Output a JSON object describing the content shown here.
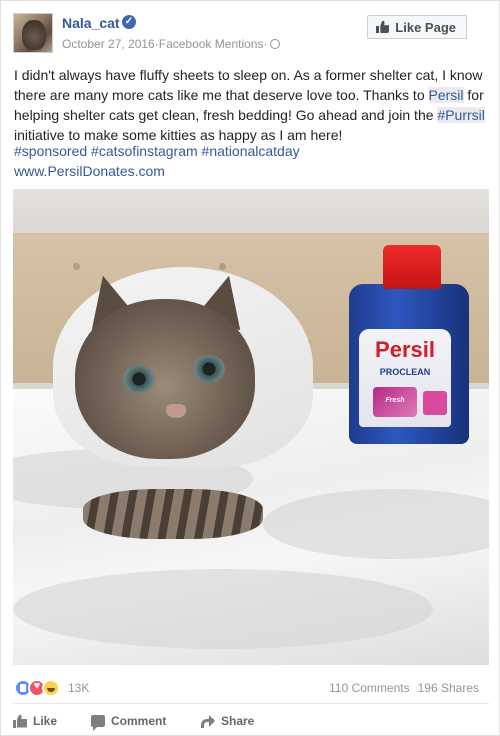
{
  "post": {
    "page_name": "Nala_cat",
    "date": "October 27, 2016",
    "source": "Facebook Mentions",
    "separator": " · ",
    "like_page_label": "Like Page",
    "text_part1": "I didn't always have fluffy sheets to sleep on. As a former shelter cat, I know there are many more cats like me that deserve love too. Thanks to ",
    "persil_link": "Persil",
    "text_part2": " for helping shelter cats get clean, fresh bedding! Go ahead and join the ",
    "purrsil_tag": "#Purrsil",
    "text_part3": " initiative to make some kitties as happy as I am here!",
    "hashtags": "#sponsored #catsofinstagram #nationalcatday",
    "url": "www.PersilDonates.com"
  },
  "photo": {
    "brand": "Persil",
    "product_line": "PROCLEAN",
    "scent": "Fresh"
  },
  "stats": {
    "reaction_count": "13K",
    "comments": "110 Comments",
    "shares": "196 Shares"
  },
  "actions": {
    "like": "Like",
    "comment": "Comment",
    "share": "Share"
  },
  "icons": {
    "verified": "verified-badge-icon",
    "audience": "globe-icon",
    "like_page": "thumbs-up-icon",
    "reactions": [
      "like-reaction-icon",
      "love-reaction-icon",
      "haha-reaction-icon"
    ]
  },
  "colors": {
    "link": "#365899",
    "verified_badge": "#4267b2",
    "meta_text": "#90949c"
  }
}
